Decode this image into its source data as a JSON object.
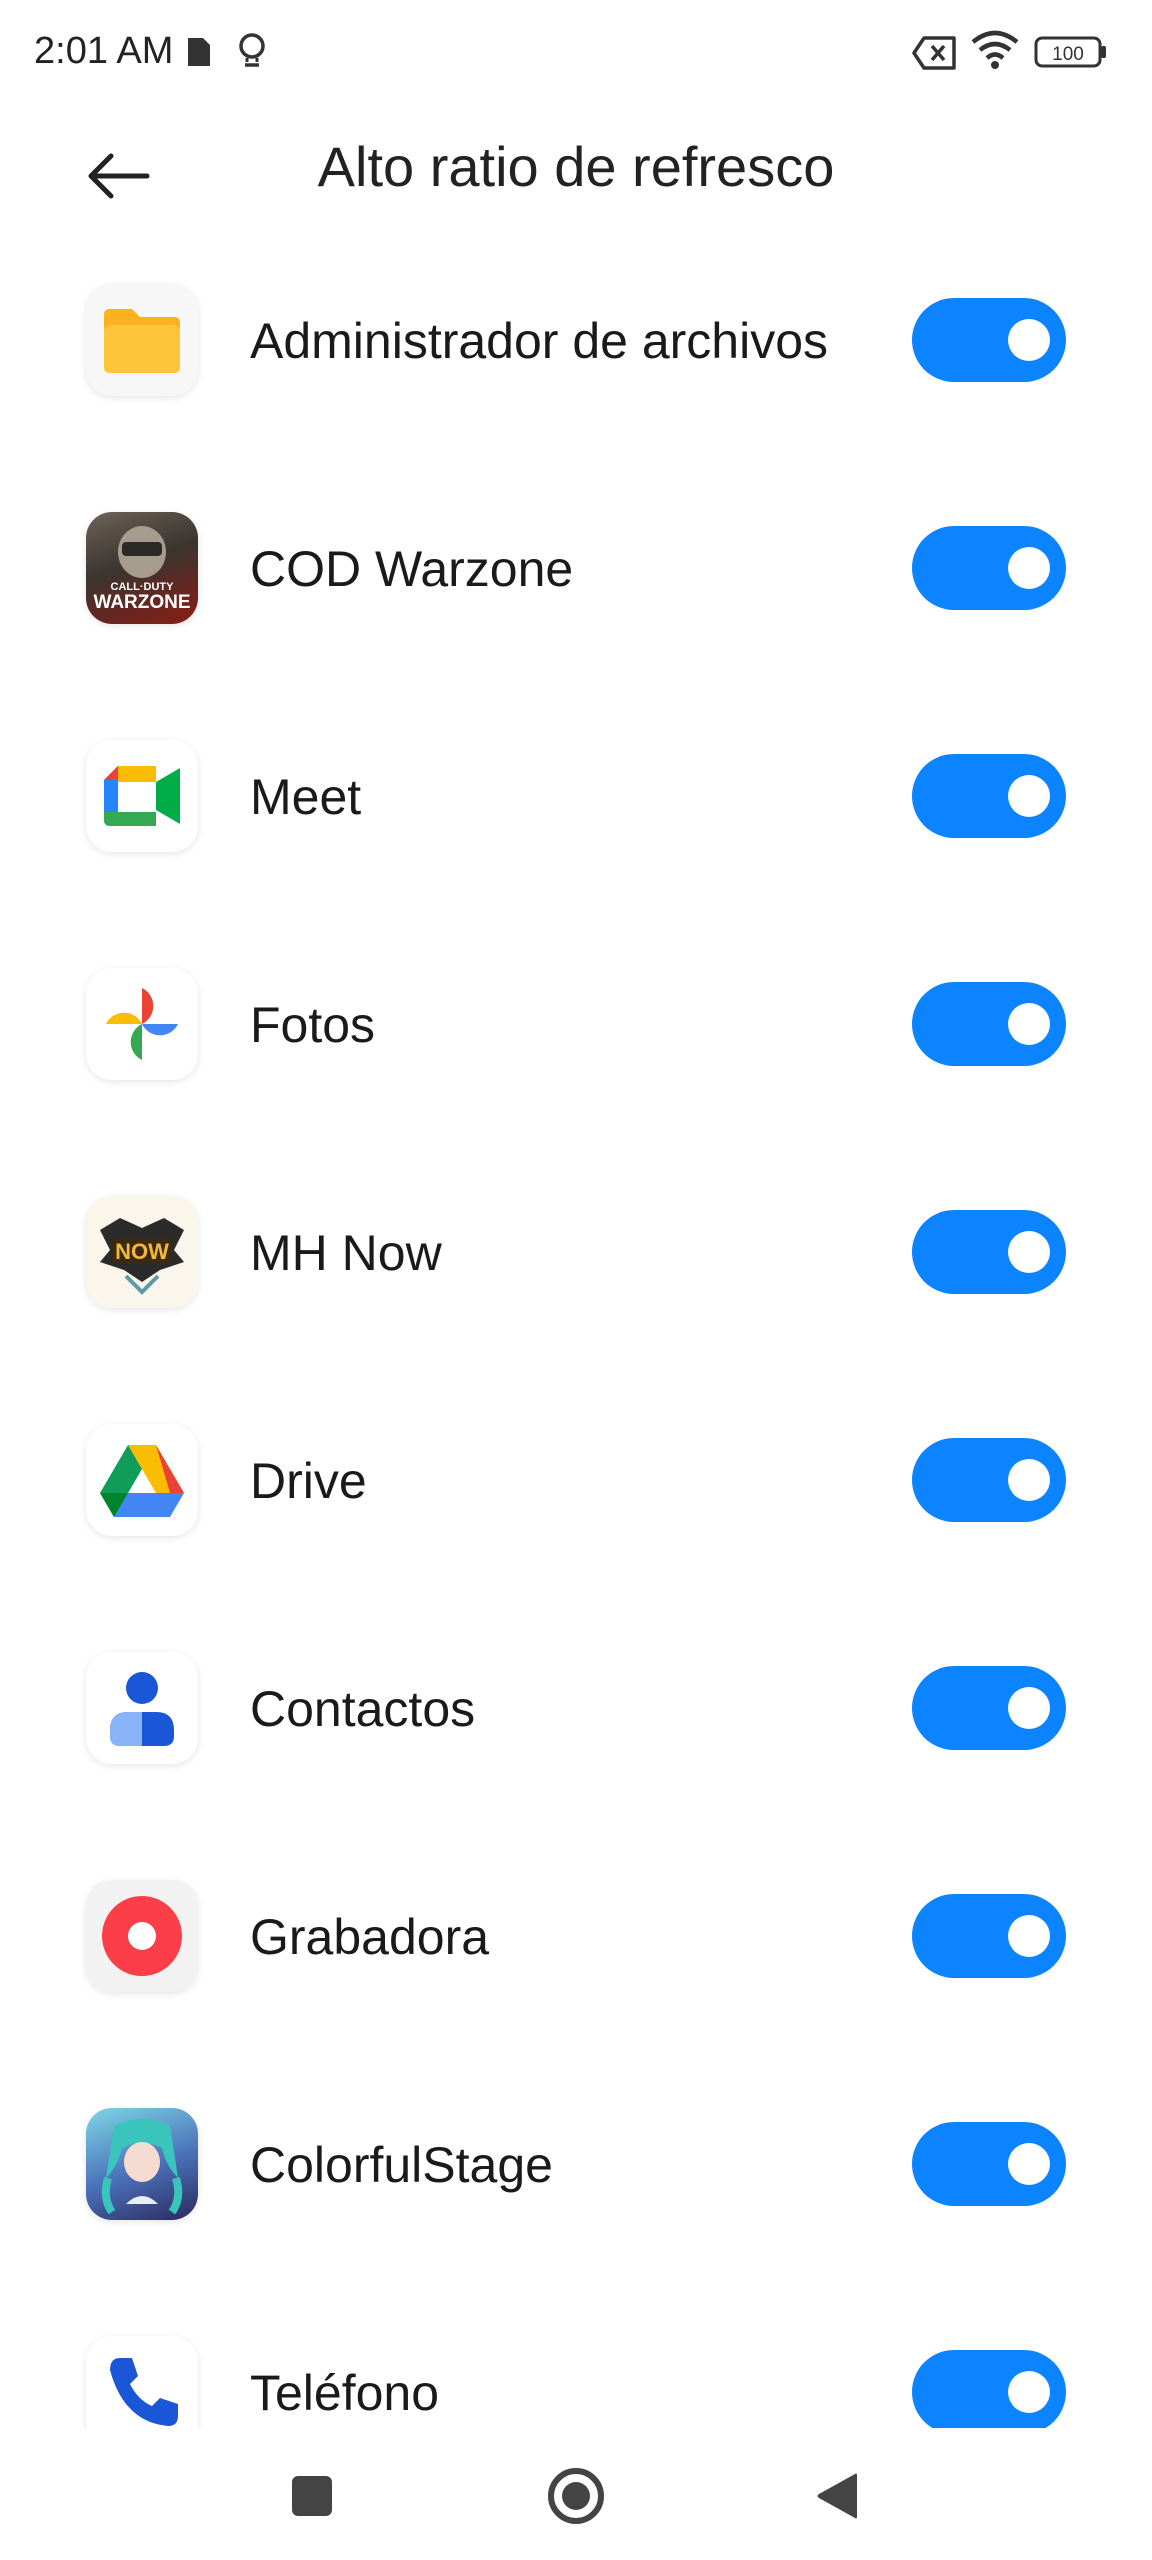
{
  "status_bar": {
    "time": "2:01 AM",
    "battery": "100",
    "icons": [
      "sim-card-icon",
      "lightbulb-icon",
      "no-sim-icon",
      "wifi-icon",
      "battery-icon"
    ]
  },
  "header": {
    "title": "Alto ratio de refresco",
    "back_icon": "back-arrow-icon"
  },
  "accent_color": "#0d84ff",
  "apps": [
    {
      "label": "Administrador de archivos",
      "icon": "folder-icon",
      "enabled": true
    },
    {
      "label": "COD Warzone",
      "icon": "warzone-icon",
      "enabled": true
    },
    {
      "label": "Meet",
      "icon": "meet-icon",
      "enabled": true
    },
    {
      "label": "Fotos",
      "icon": "photos-pinwheel-icon",
      "enabled": true
    },
    {
      "label": "MH Now",
      "icon": "mh-now-icon",
      "enabled": true
    },
    {
      "label": "Drive",
      "icon": "drive-icon",
      "enabled": true
    },
    {
      "label": "Contactos",
      "icon": "contacts-icon",
      "enabled": true
    },
    {
      "label": "Grabadora",
      "icon": "recorder-icon",
      "enabled": true
    },
    {
      "label": "ColorfulStage",
      "icon": "colorful-stage-icon",
      "enabled": true
    },
    {
      "label": "Teléfono",
      "icon": "phone-icon",
      "enabled": true
    }
  ],
  "nav_bar": {
    "icons": [
      "recents-square-icon",
      "home-circle-icon",
      "back-triangle-icon"
    ]
  }
}
